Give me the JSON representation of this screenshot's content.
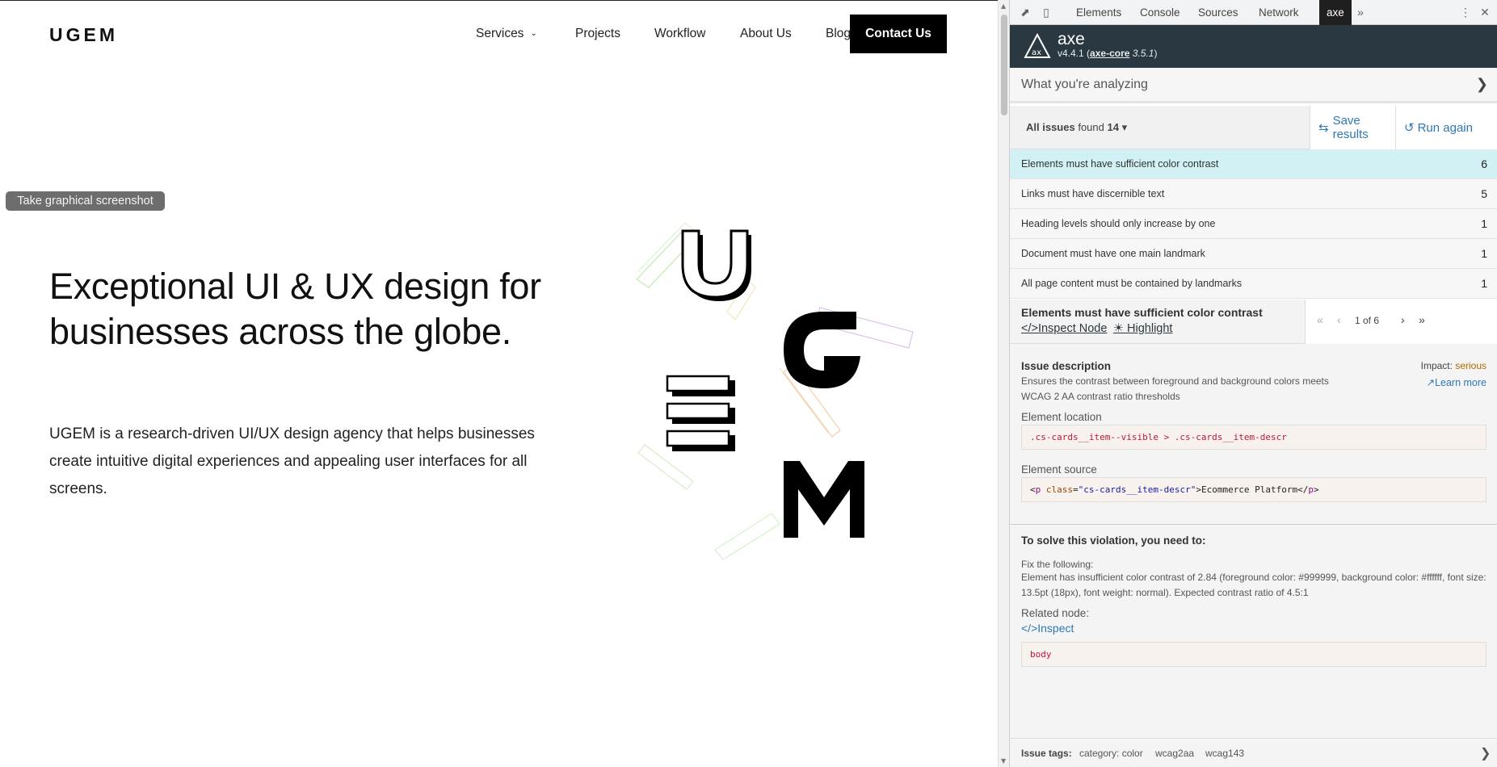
{
  "site": {
    "logo": "UGEM",
    "nav": [
      "Services",
      "Projects",
      "Workflow",
      "About Us",
      "Blog"
    ],
    "contact_label": "Contact Us",
    "tooltip": "Take graphical screenshot",
    "hero_title": "Exceptional UI & UX design for businesses across the globe.",
    "hero_text": "UGEM is a research-driven UI/UX design agency that helps businesses create intuitive digital experiences and appealing user interfaces for all screens.",
    "art_letters": [
      "U",
      "G",
      "E",
      "M"
    ]
  },
  "devtools": {
    "tabs": [
      "Elements",
      "Console",
      "Sources",
      "Network",
      "axe"
    ],
    "active_tab": "axe",
    "more_tabs_icon": "double-chevron-right-icon",
    "axe": {
      "name": "axe",
      "version": "v4.4.1",
      "core_link": "axe-core",
      "core_version": "3.5.1",
      "analyzing": "What you're analyzing",
      "all_issues_label": "All issues",
      "found_label": "found",
      "issue_count": "14",
      "save_label": "Save results",
      "run_label": "Run again",
      "rules": [
        {
          "label": "Elements must have sufficient color contrast",
          "count": "6"
        },
        {
          "label": "Links must have discernible text",
          "count": "5"
        },
        {
          "label": "Heading levels should only increase by one",
          "count": "1"
        },
        {
          "label": "Document must have one main landmark",
          "count": "1"
        },
        {
          "label": "All page content must be contained by landmarks",
          "count": "1"
        }
      ],
      "detail": {
        "title": "Elements must have sufficient color contrast",
        "inspect_label": "Inspect Node",
        "highlight_label": "Highlight",
        "pager": "1 of 6",
        "issue_desc_title": "Issue description",
        "issue_desc": "Ensures the contrast between foreground and background colors meets WCAG 2 AA contrast ratio thresholds",
        "impact_label": "Impact:",
        "impact_value": "serious",
        "learn_more": "Learn more",
        "location_label": "Element location",
        "location": ".cs-cards__item--visible > .cs-cards__item-descr",
        "source_label": "Element source",
        "source_tag": "p",
        "source_attr": "class",
        "source_attr_value": "cs-cards__item-descr",
        "source_text": "Ecommerce Platform",
        "solve_title": "To solve this violation, you need to:",
        "fix_label": "Fix the following:",
        "fix_text": "Element has insufficient color contrast of 2.84 (foreground color: #999999, background color: #ffffff, font size: 13.5pt (18px), font weight: normal). Expected contrast ratio of 4.5:1",
        "related_label": "Related node:",
        "related_inspect": "Inspect",
        "related_node": "body"
      },
      "tags_label": "Issue tags:",
      "tags": [
        "category: color",
        "wcag2aa",
        "wcag143"
      ]
    }
  },
  "colors": {
    "axe_header": "#2a3841",
    "selected_rule": "#d2f1f4",
    "link": "#2f77b5",
    "impact_serious": "#b06a00",
    "code_red": "#c0143c"
  }
}
